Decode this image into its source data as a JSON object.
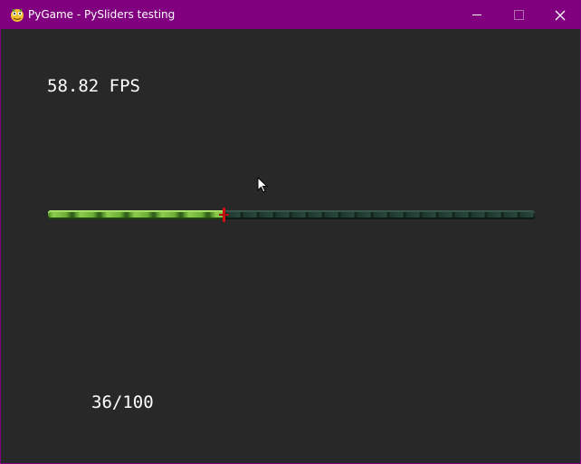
{
  "window": {
    "title": "PyGame - PySliders testing",
    "accent_color": "#800080",
    "background_color": "#282828",
    "app_icon": "pygame-snake-icon",
    "controls": {
      "minimize_icon": "minimize-icon",
      "maximize_icon": "maximize-icon",
      "close_icon": "close-icon",
      "close_glyph": "✕"
    }
  },
  "hud": {
    "fps_text": "58.82 FPS"
  },
  "slider": {
    "value": 36,
    "max": 100,
    "readout": "36/100",
    "fill_color": "#6caf38",
    "empty_color": "#1e3a30",
    "thumb_color": "#d01010"
  }
}
